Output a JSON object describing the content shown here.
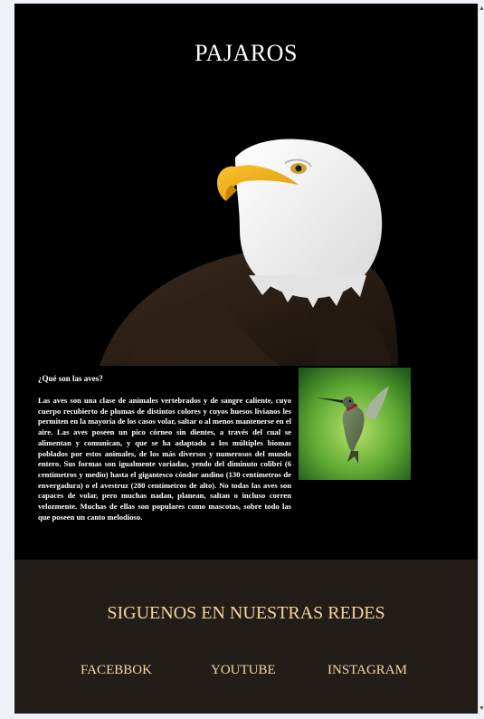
{
  "header": {
    "title": "PAJAROS"
  },
  "intro": {
    "question": "¿Qué son las aves?",
    "paragraph": "Las aves son una clase de animales vertebrados y de sangre caliente, cuyo cuerpo recubierto de plumas de distintos colores y cuyos huesos livianos les permiten en la mayoría de los casos volar, saltar o al menos mantenerse en el aire. Las aves poseen un pico córneo sin dientes, a través del cual se alimentan y comunican, y que se ha adaptado a los múltiples biomas poblados por estos animales, de los más diversos y numerosos del mundo entero. Sus formas son igualmente variadas, yendo del diminuto colibrí (6 centímetros y medio) hasta el gigantesco cóndor andino (130 centímetros de envergadura) o el avestruz (280 centímetros de alto). No todas las aves son capaces de volar, pero muchas nadan, planean, saltan o incluso corren velozmente. Muchas de ellas son populares como mascotas, sobre todo las que poseen un canto melodioso."
  },
  "footer": {
    "follow_text": "SIGUENOS EN NUESTRAS REDES",
    "links": {
      "facebook": "FACEBBOK",
      "youtube": "YOUTUBE",
      "instagram": "INSTAGRAM"
    }
  },
  "colors": {
    "page_background": "#000000",
    "footer_background": "#221d19",
    "footer_text": "#f6d69a",
    "title_text": "#ffffff"
  },
  "icons": {
    "scroll_up": "scroll-up-icon",
    "scroll_down": "scroll-down-icon"
  }
}
